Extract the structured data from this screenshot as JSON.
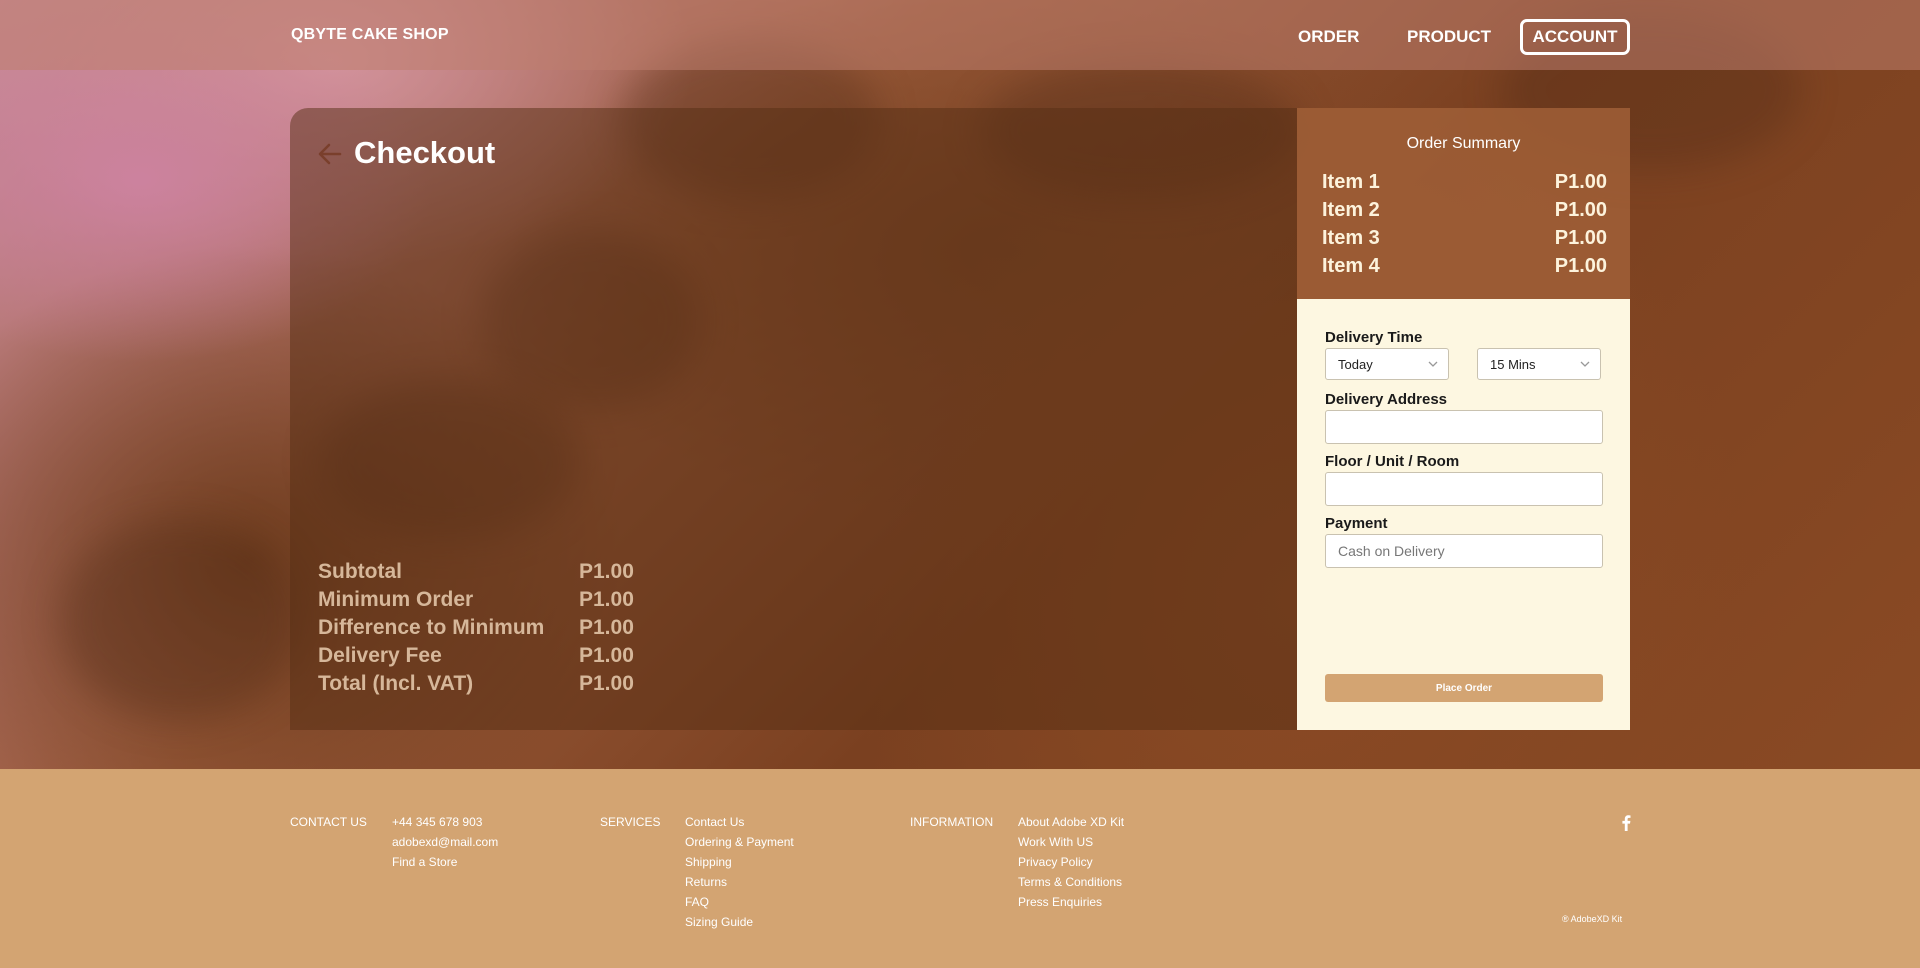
{
  "nav": {
    "brand": "QBYTE CAKE SHOP",
    "links": [
      "ORDER",
      "PRODUCT"
    ],
    "account": "ACCOUNT"
  },
  "checkout": {
    "title": "Checkout",
    "totals": [
      {
        "label": "Subtotal",
        "value": "P1.00"
      },
      {
        "label": "Minimum Order",
        "value": "P1.00"
      },
      {
        "label": "Difference to Minimum",
        "value": "P1.00"
      },
      {
        "label": "Delivery Fee",
        "value": "P1.00"
      },
      {
        "label": "Total (Incl. VAT)",
        "value": "P1.00"
      }
    ]
  },
  "summary": {
    "title": "Order Summary",
    "items": [
      {
        "name": "Item 1",
        "price": "P1.00"
      },
      {
        "name": "Item 2",
        "price": "P1.00"
      },
      {
        "name": "Item 3",
        "price": "P1.00"
      },
      {
        "name": "Item 4",
        "price": "P1.00"
      }
    ]
  },
  "form": {
    "delivery_time_label": "Delivery Time",
    "day_value": "Today",
    "time_value": "15 Mins",
    "address_label": "Delivery Address",
    "address_value": "",
    "floor_label": "Floor / Unit / Room",
    "floor_value": "",
    "payment_label": "Payment",
    "payment_placeholder": "Cash on Delivery",
    "place_order": "Place Order"
  },
  "footer": {
    "contact_head": "CONTACT US",
    "contact": [
      "+44 345 678 903",
      "adobexd@mail.com",
      "Find a Store"
    ],
    "services_head": "SERVICES",
    "services": [
      "Contact Us",
      "Ordering & Payment",
      "Shipping",
      "Returns",
      "FAQ",
      "Sizing Guide"
    ],
    "info_head": "INFORMATION",
    "info": [
      "About Adobe XD Kit",
      "Work With US",
      "Privacy Policy",
      "Terms & Conditions",
      "Press Enquiries"
    ],
    "social_icon": "facebook-icon",
    "copyright": "® AdobeXD Kit"
  },
  "colors": {
    "footer_bg": "#d3a472",
    "form_bg": "#fdf7e1",
    "button": "#d3a472"
  }
}
